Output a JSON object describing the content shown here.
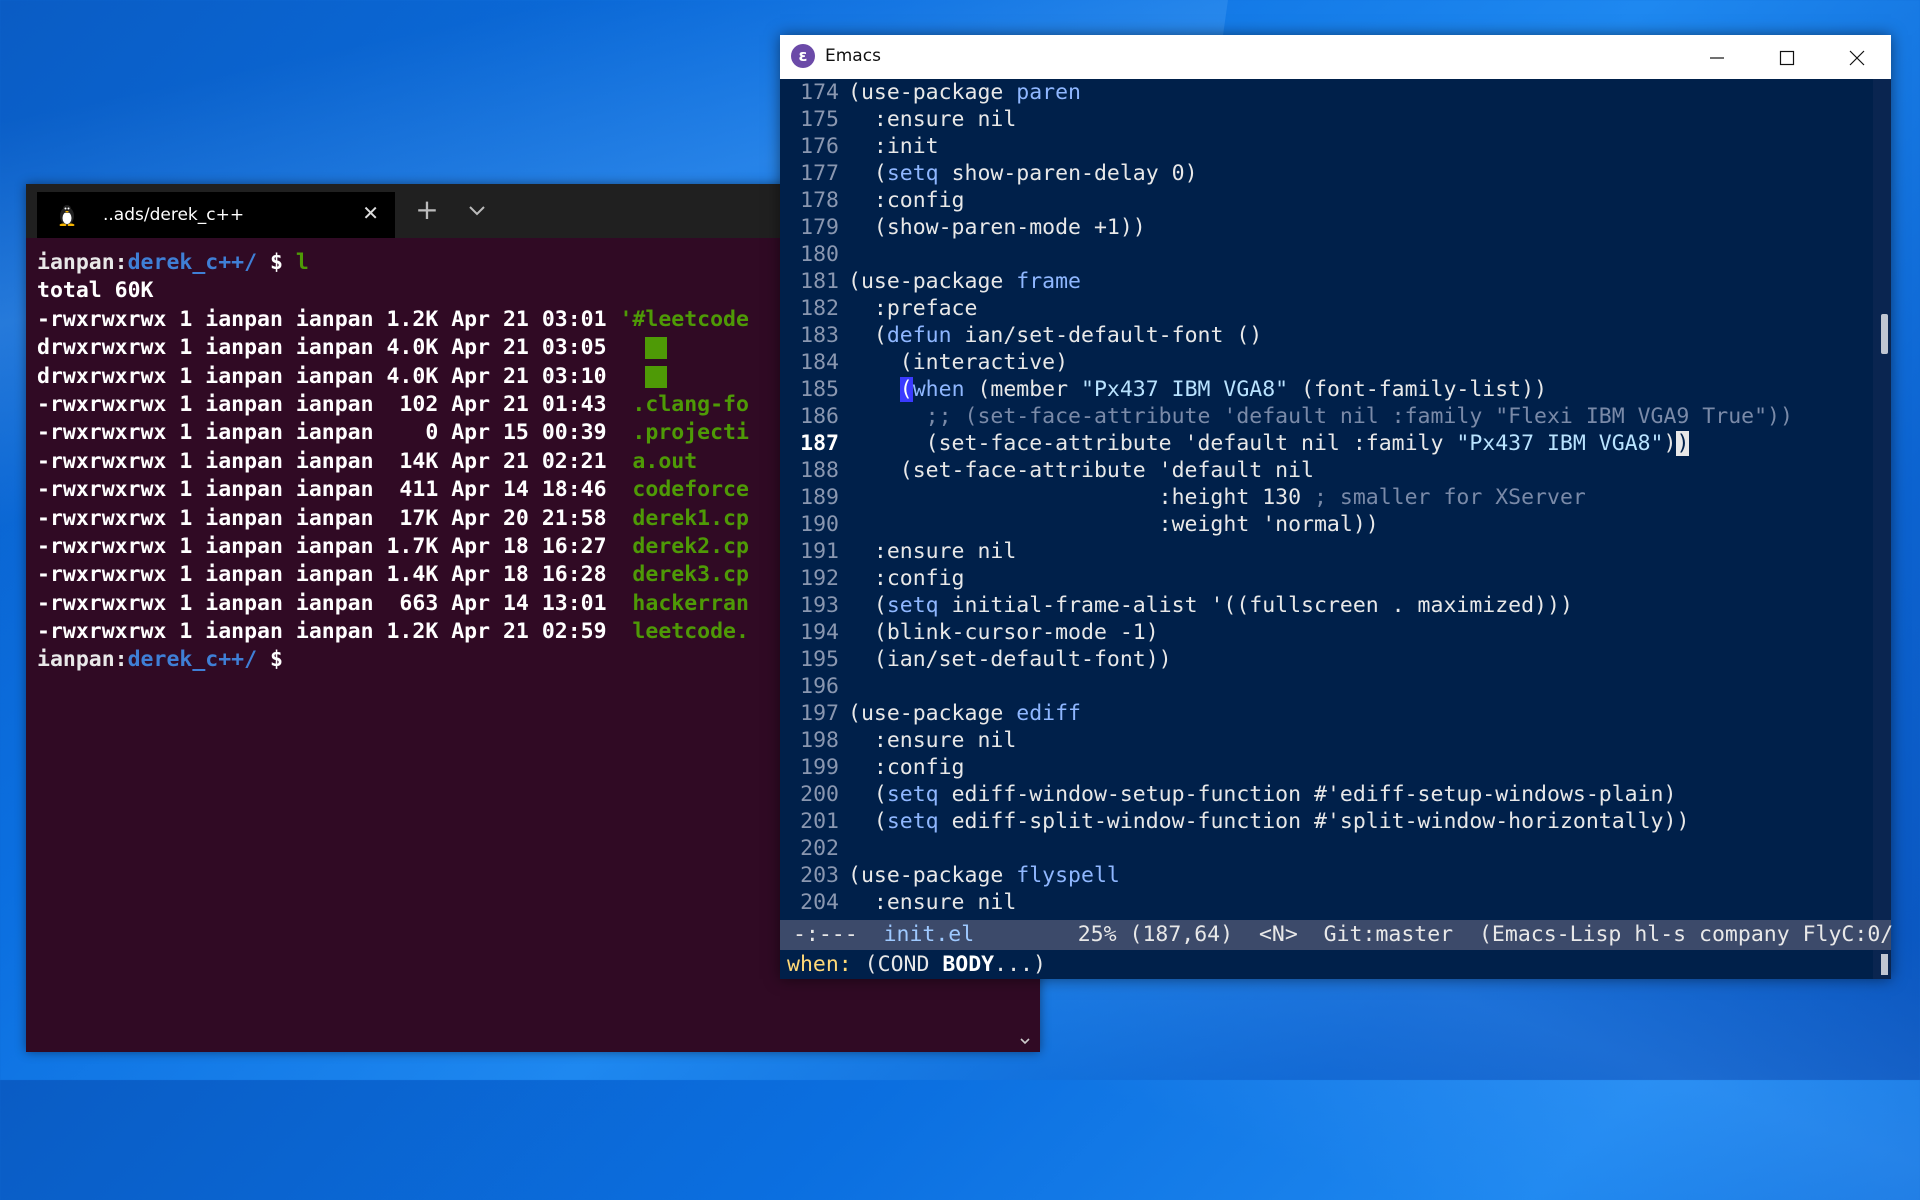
{
  "terminal": {
    "tab_title": "..ads/derek_c++",
    "tab_close": "✕",
    "new_tab": "+",
    "lines": [
      {
        "type": "prompt",
        "user": "ianpan:",
        "path": "derek_c++/",
        "sym": " $ ",
        "cmd": "l"
      },
      {
        "type": "text",
        "text": "total 60K"
      },
      {
        "type": "ls",
        "meta": "-rwxrwxrwx 1 ianpan ianpan 1.2K Apr 21 03:01 ",
        "name": "'#leetcode"
      },
      {
        "type": "dir",
        "meta": "drwxrwxrwx 1 ianpan ianpan 4.0K Apr 21 03:05 ",
        "name": ""
      },
      {
        "type": "dir",
        "meta": "drwxrwxrwx 1 ianpan ianpan 4.0K Apr 21 03:10 ",
        "name": ""
      },
      {
        "type": "ls",
        "meta": "-rwxrwxrwx 1 ianpan ianpan  102 Apr 21 01:43 ",
        "name": " .clang-fo"
      },
      {
        "type": "ls",
        "meta": "-rwxrwxrwx 1 ianpan ianpan    0 Apr 15 00:39 ",
        "name": " .projecti"
      },
      {
        "type": "ls",
        "meta": "-rwxrwxrwx 1 ianpan ianpan  14K Apr 21 02:21 ",
        "name": " a.out"
      },
      {
        "type": "ls",
        "meta": "-rwxrwxrwx 1 ianpan ianpan  411 Apr 14 18:46 ",
        "name": " codeforce"
      },
      {
        "type": "ls",
        "meta": "-rwxrwxrwx 1 ianpan ianpan  17K Apr 20 21:58 ",
        "name": " derek1.cp"
      },
      {
        "type": "ls",
        "meta": "-rwxrwxrwx 1 ianpan ianpan 1.7K Apr 18 16:27 ",
        "name": " derek2.cp"
      },
      {
        "type": "ls",
        "meta": "-rwxrwxrwx 1 ianpan ianpan 1.4K Apr 18 16:28 ",
        "name": " derek3.cp"
      },
      {
        "type": "ls",
        "meta": "-rwxrwxrwx 1 ianpan ianpan  663 Apr 14 13:01 ",
        "name": " hackerran"
      },
      {
        "type": "ls",
        "meta": "-rwxrwxrwx 1 ianpan ianpan 1.2K Apr 21 02:59 ",
        "name": " leetcode."
      },
      {
        "type": "prompt",
        "user": "ianpan:",
        "path": "derek_c++/",
        "sym": " $ ",
        "cmd": ""
      }
    ]
  },
  "emacs": {
    "title": "Emacs",
    "lines": [
      {
        "n": "174",
        "parts": [
          [
            "",
            "(use-package "
          ],
          [
            "kw",
            "paren"
          ]
        ]
      },
      {
        "n": "175",
        "parts": [
          [
            "",
            "  :ensure nil"
          ]
        ]
      },
      {
        "n": "176",
        "parts": [
          [
            "",
            "  :init"
          ]
        ]
      },
      {
        "n": "177",
        "parts": [
          [
            "",
            "  ("
          ],
          [
            "kw",
            "setq"
          ],
          [
            "",
            " show-paren-delay 0)"
          ]
        ]
      },
      {
        "n": "178",
        "parts": [
          [
            "",
            "  :config"
          ]
        ]
      },
      {
        "n": "179",
        "parts": [
          [
            "",
            "  (show-paren-mode +1))"
          ]
        ]
      },
      {
        "n": "180",
        "parts": []
      },
      {
        "n": "181",
        "parts": [
          [
            "",
            "(use-package "
          ],
          [
            "kw",
            "frame"
          ]
        ]
      },
      {
        "n": "182",
        "parts": [
          [
            "",
            "  :preface"
          ]
        ]
      },
      {
        "n": "183",
        "parts": [
          [
            "",
            "  ("
          ],
          [
            "kw",
            "defun"
          ],
          [
            "",
            " ian/set-default-font ()"
          ]
        ]
      },
      {
        "n": "184",
        "parts": [
          [
            "",
            "    (interactive)"
          ]
        ]
      },
      {
        "n": "185",
        "parts": [
          [
            "",
            "    "
          ],
          [
            "cur",
            "("
          ],
          [
            "kw",
            "when"
          ],
          [
            "",
            " (member "
          ],
          [
            "str",
            "\"Px437 IBM VGA8\""
          ],
          [
            "",
            " (font-family-list))"
          ]
        ]
      },
      {
        "n": "186",
        "parts": [
          [
            "cmt",
            "      ;; (set-face-attribute 'default nil :family \"Flexi IBM VGA9 True\"))"
          ]
        ]
      },
      {
        "n": "187",
        "cur": true,
        "parts": [
          [
            "",
            "      (set-face-attribute 'default nil :family "
          ],
          [
            "str",
            "\"Px437 IBM VGA8\""
          ],
          [
            "",
            ")"
          ],
          [
            "cur-end",
            ")"
          ]
        ]
      },
      {
        "n": "188",
        "parts": [
          [
            "",
            "    (set-face-attribute 'default nil"
          ]
        ]
      },
      {
        "n": "189",
        "parts": [
          [
            "",
            "                        :height 130 "
          ],
          [
            "cmt",
            "; smaller for XServer"
          ]
        ]
      },
      {
        "n": "190",
        "parts": [
          [
            "",
            "                        :weight 'normal))"
          ]
        ]
      },
      {
        "n": "191",
        "parts": [
          [
            "",
            "  :ensure nil"
          ]
        ]
      },
      {
        "n": "192",
        "parts": [
          [
            "",
            "  :config"
          ]
        ]
      },
      {
        "n": "193",
        "parts": [
          [
            "",
            "  ("
          ],
          [
            "kw",
            "setq"
          ],
          [
            "",
            " initial-frame-alist '((fullscreen . maximized)))"
          ]
        ]
      },
      {
        "n": "194",
        "parts": [
          [
            "",
            "  (blink-cursor-mode -1)"
          ]
        ]
      },
      {
        "n": "195",
        "parts": [
          [
            "",
            "  (ian/set-default-font))"
          ]
        ]
      },
      {
        "n": "196",
        "parts": []
      },
      {
        "n": "197",
        "parts": [
          [
            "",
            "(use-package "
          ],
          [
            "kw",
            "ediff"
          ]
        ]
      },
      {
        "n": "198",
        "parts": [
          [
            "",
            "  :ensure nil"
          ]
        ]
      },
      {
        "n": "199",
        "parts": [
          [
            "",
            "  :config"
          ]
        ]
      },
      {
        "n": "200",
        "parts": [
          [
            "",
            "  ("
          ],
          [
            "kw",
            "setq"
          ],
          [
            "",
            " ediff-window-setup-function #'ediff-setup-windows-plain)"
          ]
        ]
      },
      {
        "n": "201",
        "parts": [
          [
            "",
            "  ("
          ],
          [
            "kw",
            "setq"
          ],
          [
            "",
            " ediff-split-window-function #'split-window-horizontally))"
          ]
        ]
      },
      {
        "n": "202",
        "parts": []
      },
      {
        "n": "203",
        "parts": [
          [
            "",
            "(use-package "
          ],
          [
            "kw",
            "flyspell"
          ]
        ]
      },
      {
        "n": "204",
        "parts": [
          [
            "",
            "  :ensure nil"
          ]
        ]
      }
    ],
    "modeline": {
      "status": " -:---  ",
      "buffer": "init.el",
      "position": "        25% (187,64)  <N>  Git:master  (Emacs-Lisp hl-s company FlyC:0/"
    },
    "minibuffer": {
      "prefix": "when:",
      "cond": " (COND ",
      "body": "BODY",
      "suffix": "...)"
    }
  }
}
